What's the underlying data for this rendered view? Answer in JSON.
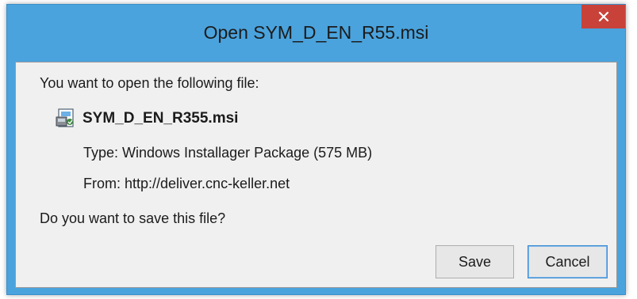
{
  "dialog": {
    "title": "Open SYM_D_EN_R55.msi",
    "prompt": "You want to open the following file:",
    "file_name": "SYM_D_EN_R355.msi",
    "file_icon": "installer-package-icon",
    "type_line": "Type: Windows Installager Package (575 MB)",
    "from_line": "From: http://deliver.cnc-keller.net",
    "question": "Do you want to save this file?",
    "save_label": "Save",
    "cancel_label": "Cancel",
    "colors": {
      "titlebar": "#4aa3dd",
      "close_button": "#c8423a",
      "client_background": "#f0f0f0",
      "default_button_border": "#3c8fd0"
    }
  }
}
